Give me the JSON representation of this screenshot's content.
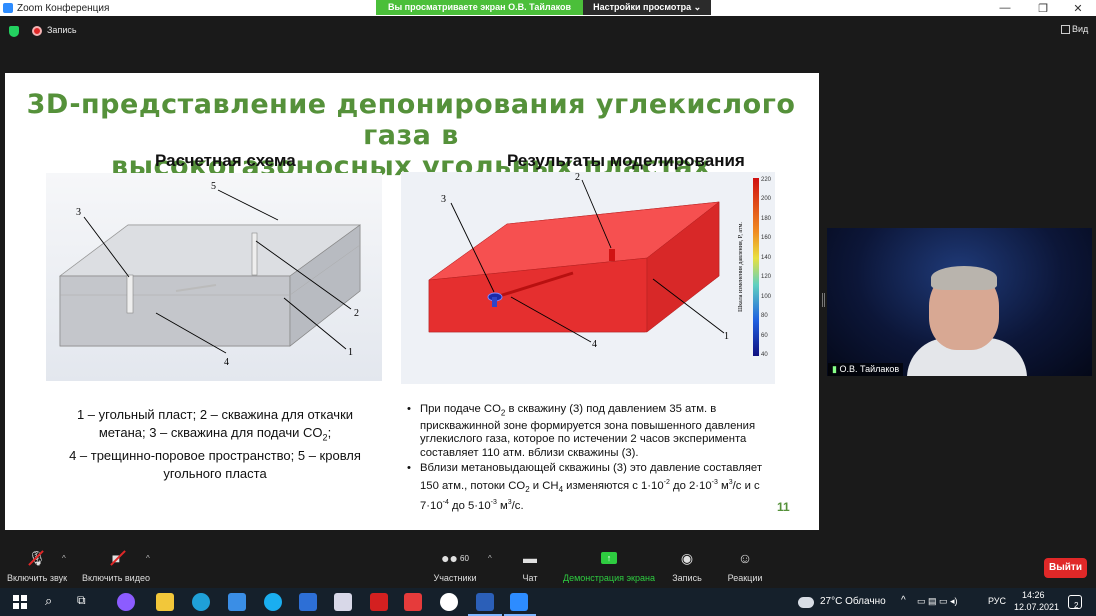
{
  "window": {
    "title": "Zoom Конференция",
    "minimize": "—",
    "maximize": "❐",
    "close": "✕"
  },
  "share_banner": {
    "viewing": "Вы просматриваете экран О.В. Тайлаков",
    "settings": "Настройки просмотра ⌄"
  },
  "meeting_bar": {
    "recording": "Запись",
    "view": "Вид"
  },
  "slide": {
    "title_line1": "3D-представление депонирования углекислого газа в",
    "title_line2": "высокогазоносных угольных пластах",
    "left_heading": "Расчетная схема",
    "right_heading": "Результаты моделирования",
    "scheme_labels": [
      "3",
      "5",
      "2",
      "1",
      "4"
    ],
    "results_labels": [
      "2",
      "3",
      "4",
      "1"
    ],
    "colorbar_title": "Шкала изменения давления, P, атм.",
    "colorbar_ticks": [
      "220",
      "200",
      "180",
      "160",
      "140",
      "120",
      "100",
      "80",
      "60",
      "40"
    ],
    "caption_line1": "1 – угольный пласт; 2 – скважина для откачки",
    "caption_line2_a": "метана; 3 – скважина для подачи CO",
    "caption_line2_sub": "2",
    "caption_line2_b": ";",
    "caption_line3": "4 – трещинно-поровое пространство; 5 – кровля",
    "caption_line4": "угольного пласта",
    "bullet1_a": "При подаче CO",
    "bullet1_sub": "2",
    "bullet1_b": " в скважину (3) под давлением 35 атм. в прискважинной зоне формируется зона повышенного давления углекислого газа, которое  по истечении 2 часов эксперимента составляет 110 атм. вблизи скважины (3).",
    "bullet2_a": "Вблизи метановыдающей скважины (3) это давление составляет 150 атм., потоки CO",
    "bullet2_sub1": "2",
    "bullet2_b": " и CH",
    "bullet2_sub2": "4",
    "bullet2_c": " изменяются с 1·10",
    "bullet2_sup1": "-2",
    "bullet2_d": " до 2·10",
    "bullet2_sup2": "-3",
    "bullet2_e": " м",
    "bullet2_sup3": "3",
    "bullet2_f": "/с и с 7·10",
    "bullet2_sup4": "-4",
    "bullet2_g": " до 5·10",
    "bullet2_sup5": "-3",
    "bullet2_h": " м",
    "bullet2_sup6": "3",
    "bullet2_i": "/с.",
    "page_number": "11"
  },
  "video": {
    "participant": "О.В. Тайлаков"
  },
  "toolbar": {
    "mute": "Включить звук",
    "video": "Включить видео",
    "participants": "Участники",
    "participants_count": "60",
    "chat": "Чат",
    "share": "Демонстрация экрана",
    "record": "Запись",
    "reactions": "Реакции",
    "leave": "Выйти"
  },
  "taskbar": {
    "weather": "27°C  Облачно",
    "lang": "РУС",
    "time": "14:26",
    "date": "12.07.2021",
    "notifications": "2"
  },
  "colors": {
    "title_green": "#55913a",
    "share_green": "#2ecc40",
    "leave_red": "#e02828",
    "pressure_red": "#f03a3a"
  }
}
